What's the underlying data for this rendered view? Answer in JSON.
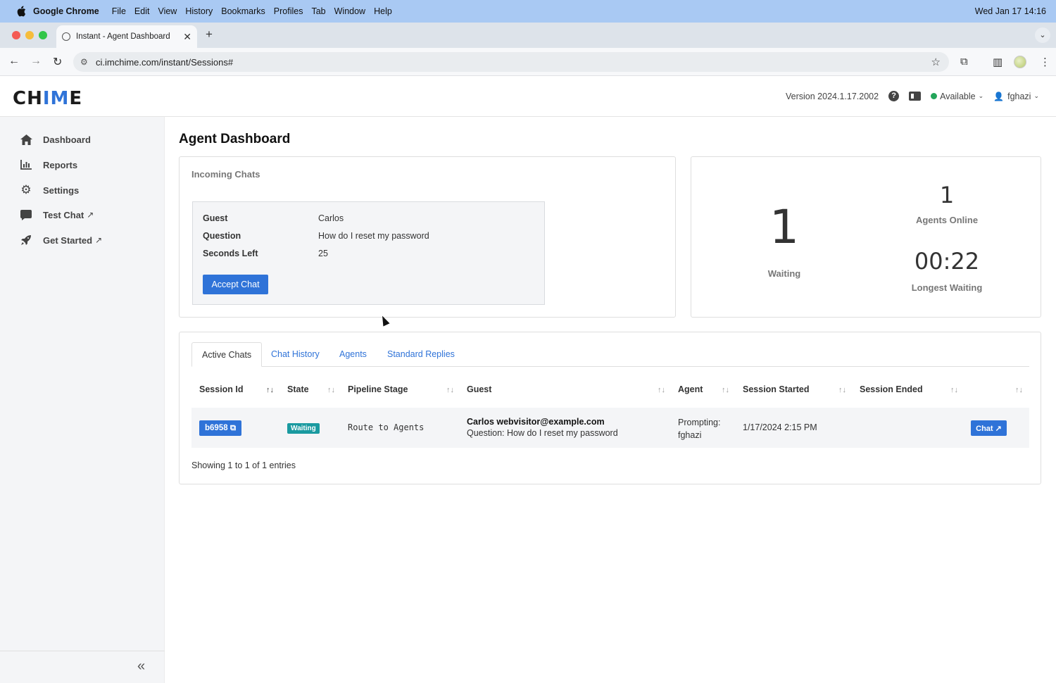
{
  "macos": {
    "app_name": "Google Chrome",
    "menus": [
      "File",
      "Edit",
      "View",
      "History",
      "Bookmarks",
      "Profiles",
      "Tab",
      "Window",
      "Help"
    ],
    "clock": "Wed Jan 17  14:16"
  },
  "browser": {
    "tab_title": "Instant - Agent Dashboard",
    "url": "ci.imchime.com/instant/Sessions#"
  },
  "header": {
    "logo_prefix": "CH",
    "logo_accent": "IM",
    "logo_suffix": "E",
    "version": "Version 2024.1.17.2002",
    "status": "Available",
    "user": "fghazi",
    "status_color": "#23a55a",
    "accent_color": "#2f73d8"
  },
  "sidebar": {
    "items": [
      {
        "label": "Dashboard",
        "icon": "home-icon"
      },
      {
        "label": "Reports",
        "icon": "bar-chart-icon"
      },
      {
        "label": "Settings",
        "icon": "gear-icon"
      },
      {
        "label": "Test Chat",
        "icon": "chat-bubble-icon",
        "external": "↗"
      },
      {
        "label": "Get Started",
        "icon": "rocket-icon",
        "external": "↗"
      }
    ],
    "collapse_glyph": "«"
  },
  "main": {
    "title": "Agent Dashboard",
    "incoming": {
      "title": "Incoming Chats",
      "guest_label": "Guest",
      "guest_value": "Carlos",
      "question_label": "Question",
      "question_value": "How do I reset my password",
      "seconds_label": "Seconds Left",
      "seconds_value": "25",
      "accept_label": "Accept Chat"
    },
    "stats": {
      "waiting_value": "1",
      "waiting_label": "Waiting",
      "agents_online_value": "1",
      "agents_online_label": "Agents Online",
      "longest_waiting_value": "00:22",
      "longest_waiting_label": "Longest Waiting"
    },
    "tabs": [
      "Active Chats",
      "Chat History",
      "Agents",
      "Standard Replies"
    ],
    "table": {
      "columns": [
        "Session Id",
        "State",
        "Pipeline Stage",
        "Guest",
        "Agent",
        "Session Started",
        "Session Ended"
      ],
      "rows": [
        {
          "session_id": "b6958",
          "state": "Waiting",
          "pipeline_stage": "Route to Agents",
          "guest_name": "Carlos webvisitor@example.com",
          "guest_question": "Question: How do I reset my password",
          "agent_line1": "Prompting:",
          "agent_line2": "fghazi",
          "session_started": "1/17/2024 2:15 PM",
          "session_ended": "",
          "chat_label": "Chat ↗"
        }
      ],
      "footer": "Showing 1 to 1 of 1 entries"
    }
  }
}
